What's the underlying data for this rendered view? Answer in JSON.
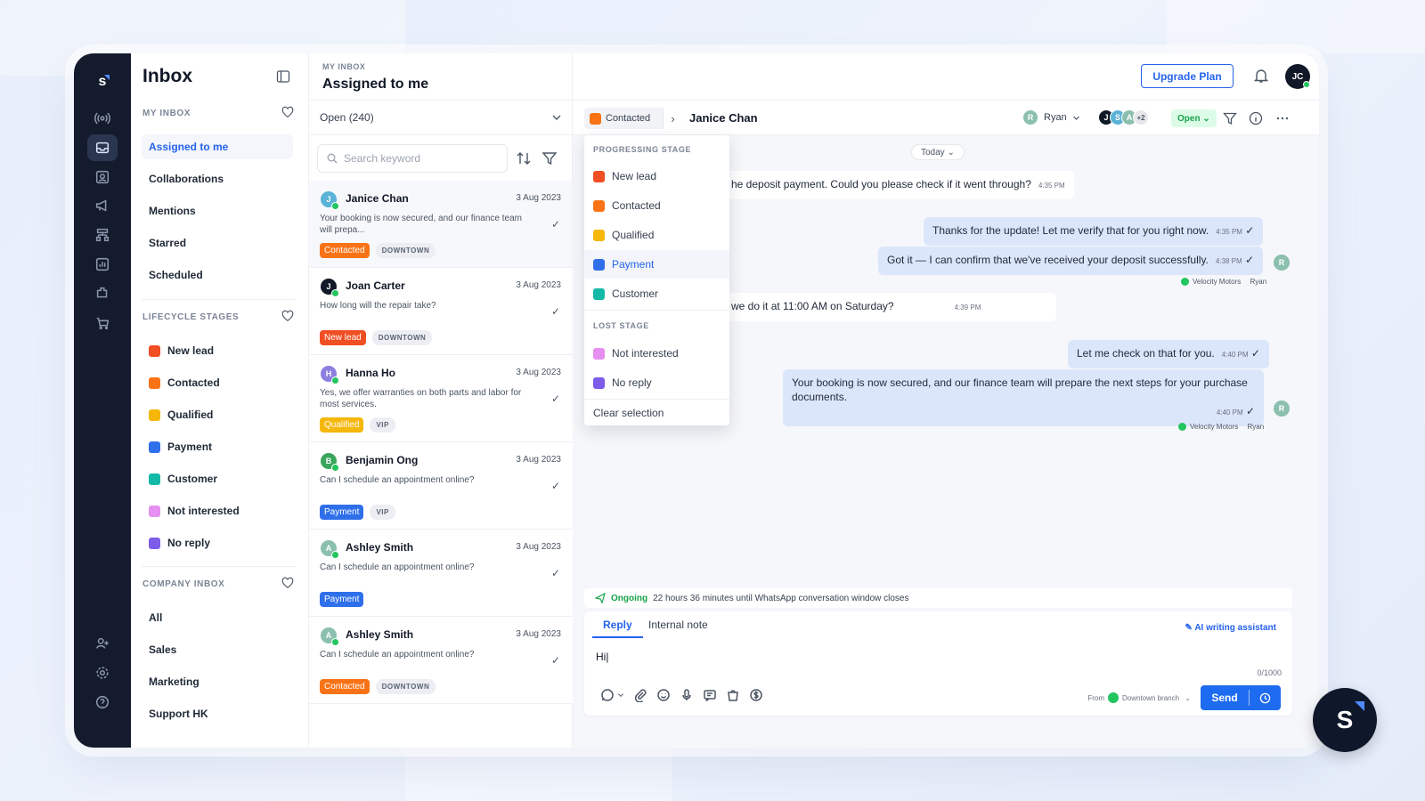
{
  "colors": {
    "accent": "#2563eb",
    "new_lead": "#f04e23",
    "contacted": "#f97316",
    "qualified": "#f5b70a",
    "payment": "#2f6fea",
    "customer": "#14b8a6",
    "not_interested": "#e58ff0",
    "no_reply": "#7c5ce8"
  },
  "app": {
    "logo": "s"
  },
  "rail": {
    "icons": [
      "broadcast-icon",
      "inbox-icon",
      "contacts-icon",
      "megaphone-icon",
      "workflow-icon",
      "reports-icon",
      "integrations-icon",
      "cart-icon",
      "add-user-icon",
      "settings-icon",
      "help-icon"
    ]
  },
  "sidebar": {
    "title": "Inbox",
    "my_inbox_label": "MY INBOX",
    "my_inbox": [
      "Assigned to me",
      "Collaborations",
      "Mentions",
      "Starred",
      "Scheduled"
    ],
    "lifecycle_label": "LIFECYCLE STAGES",
    "stages": [
      "New lead",
      "Contacted",
      "Qualified",
      "Payment",
      "Customer",
      "Not interested",
      "No reply"
    ],
    "company_label": "COMPANY INBOX",
    "company": [
      "All",
      "Sales",
      "Marketing",
      "Support HK"
    ]
  },
  "header": {
    "sub": "MY INBOX",
    "title": "Assigned to me",
    "upgrade": "Upgrade Plan",
    "user_initials": "JC"
  },
  "list": {
    "filter": "Open (240)",
    "search_placeholder": "Search keyword",
    "items": [
      {
        "initial": "J",
        "name": "Janice Chan",
        "date": "3 Aug 2023",
        "msg": "Your booking is now secured, and our finance team will prepa...",
        "tag1": "Contacted",
        "tag2": "DOWNTOWN",
        "avatar_color": "#5ab3d6",
        "tag1_color": "#f97316"
      },
      {
        "initial": "J",
        "name": "Joan Carter",
        "date": "3 Aug 2023",
        "msg": "How long will the repair take?",
        "tag1": "New lead",
        "tag2": "DOWNTOWN",
        "avatar_color": "#111827",
        "tag1_color": "#f04e23"
      },
      {
        "initial": "H",
        "name": "Hanna Ho",
        "date": "3 Aug 2023",
        "msg": "Yes, we offer warranties on both parts and labor for most services.",
        "tag1": "Qualified",
        "tag2": "VIP",
        "avatar_color": "#8b7fe0",
        "tag1_color": "#f5b70a"
      },
      {
        "initial": "B",
        "name": "Benjamin Ong",
        "date": "3 Aug 2023",
        "msg": "Can I schedule an appointment online?",
        "tag1": "Payment",
        "tag2": "VIP",
        "avatar_color": "#3aa55c",
        "tag1_color": "#2f6fea"
      },
      {
        "initial": "A",
        "name": "Ashley Smith",
        "date": "3 Aug 2023",
        "msg": "Can I schedule an appointment online?",
        "tag1": "Payment",
        "tag2": "",
        "avatar_color": "#8bbfae",
        "tag1_color": "#2f6fea"
      },
      {
        "initial": "A",
        "name": "Ashley Smith",
        "date": "3 Aug 2023",
        "msg": "Can I schedule an appointment online?",
        "tag1": "Contacted",
        "tag2": "DOWNTOWN",
        "avatar_color": "#8bbfae",
        "tag1_color": "#f97316"
      }
    ]
  },
  "chat": {
    "stage": "Contacted",
    "contact": "Janice Chan",
    "agent_initial": "R",
    "agent": "Ryan",
    "collab": [
      "J",
      "S",
      "A",
      "+2"
    ],
    "status": "Open",
    "today": "Today",
    "messages": [
      {
        "text": "he deposit payment. Could you please check if it went through?",
        "time": "4:35 PM"
      },
      {
        "text": "Thanks for the update! Let me verify that for you right now.",
        "time": "4:35 PM"
      },
      {
        "text": "Got it — I can confirm that we've received your deposit successfully.",
        "time": "4:38 PM"
      },
      {
        "text": "we do it at 11:00 AM on Saturday?",
        "time": "4:39 PM"
      },
      {
        "text": "Let me check on that for you.",
        "time": "4:40 PM"
      },
      {
        "text": "Your booking is now secured, and our finance team will prepare the next steps for your purchase documents.",
        "time": "4:40 PM"
      }
    ],
    "sender_meta": "Velocity Motors",
    "sender_agent": "Ryan"
  },
  "dropdown": {
    "progress_label": "PROGRESSING STAGE",
    "progress": [
      "New lead",
      "Contacted",
      "Qualified",
      "Payment",
      "Customer"
    ],
    "lost_label": "LOST STAGE",
    "lost": [
      "Not interested",
      "No reply"
    ],
    "clear": "Clear selection"
  },
  "composer": {
    "ongoing": "Ongoing",
    "ongoing_text": "22 hours 36 minutes until WhatsApp conversation window closes",
    "tab_reply": "Reply",
    "tab_note": "Internal note",
    "ai": "AI writing assistant",
    "input": "Hi|",
    "count": "0/1000",
    "from_label": "From",
    "from": "Downtown branch",
    "send": "Send"
  },
  "fab": "S"
}
